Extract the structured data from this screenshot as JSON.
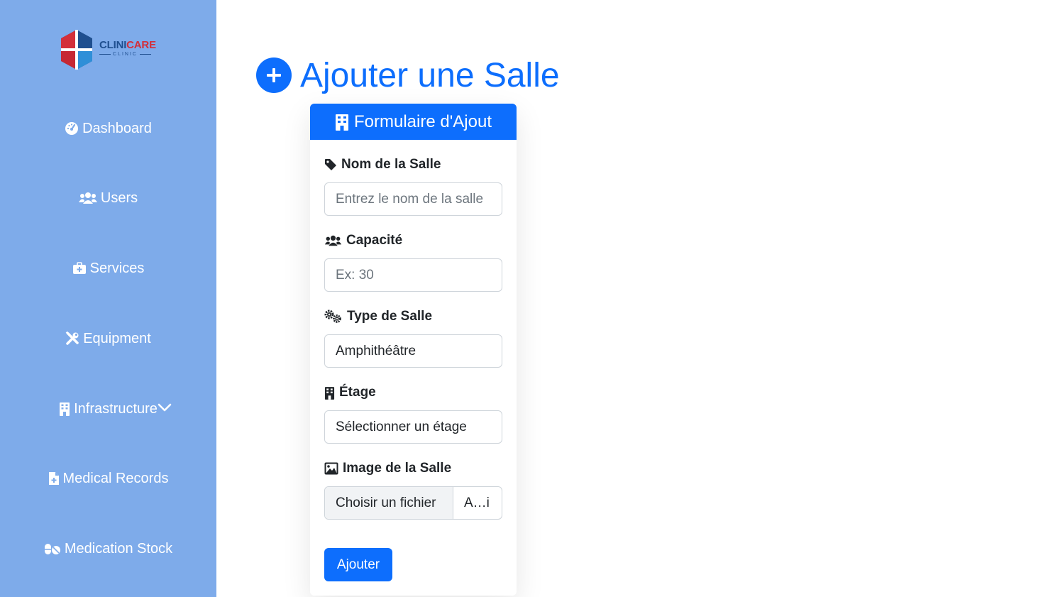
{
  "brand": {
    "name_part1": "CLINI",
    "name_part2": "CARE",
    "subtitle": "CLINIC"
  },
  "sidebar": {
    "items": [
      {
        "label": "Dashboard",
        "icon": "gauge-icon"
      },
      {
        "label": "Users",
        "icon": "users-icon"
      },
      {
        "label": "Services",
        "icon": "medical-kit-icon"
      },
      {
        "label": "Equipment",
        "icon": "tools-icon"
      },
      {
        "label": "Infrastructure",
        "icon": "building-icon",
        "has_submenu": true
      },
      {
        "label": "Medical Records",
        "icon": "file-medical-icon"
      },
      {
        "label": "Medication Stock",
        "icon": "pills-icon"
      }
    ]
  },
  "page": {
    "title": "Ajouter une Salle"
  },
  "form": {
    "header": "Formulaire d'Ajout",
    "name": {
      "label": "Nom de la Salle",
      "placeholder": "Entrez le nom de la salle"
    },
    "capacity": {
      "label": "Capacité",
      "placeholder": "Ex: 30"
    },
    "type": {
      "label": "Type de Salle",
      "value": "Amphithéâtre"
    },
    "floor": {
      "label": "Étage",
      "value": "Sélectionner un étage"
    },
    "image": {
      "label": "Image de la Salle",
      "button": "Choisir un fichier",
      "file_name": "A…i"
    },
    "submit": "Ajouter"
  },
  "colors": {
    "sidebar_bg": "#7eabea",
    "primary": "#0d6efd",
    "text": "#212529"
  }
}
